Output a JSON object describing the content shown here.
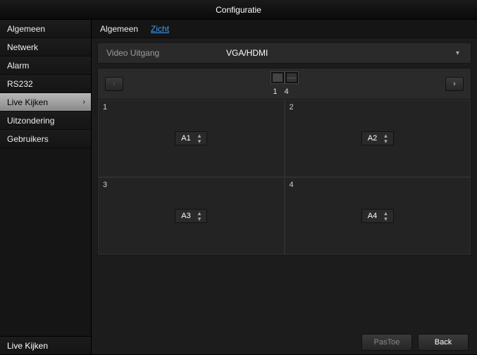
{
  "title": "Configuratie",
  "sidebar": {
    "items": [
      {
        "label": "Algemeen"
      },
      {
        "label": "Netwerk"
      },
      {
        "label": "Alarm"
      },
      {
        "label": "RS232"
      },
      {
        "label": "Live Kijken"
      },
      {
        "label": "Uitzondering"
      },
      {
        "label": "Gebruikers"
      }
    ],
    "footer": "Live Kijken"
  },
  "tabs": {
    "general": "Algemeen",
    "view": "Zicht"
  },
  "video_out": {
    "label": "Video Uitgang",
    "value": "VGA/HDMI"
  },
  "pager": {
    "current": "1",
    "total": "4"
  },
  "nav": {
    "prev": "‹",
    "next": "›"
  },
  "cells": [
    {
      "num": "1",
      "value": "A1"
    },
    {
      "num": "2",
      "value": "A2"
    },
    {
      "num": "3",
      "value": "A3"
    },
    {
      "num": "4",
      "value": "A4"
    }
  ],
  "buttons": {
    "apply": "PasToe",
    "back": "Back"
  }
}
